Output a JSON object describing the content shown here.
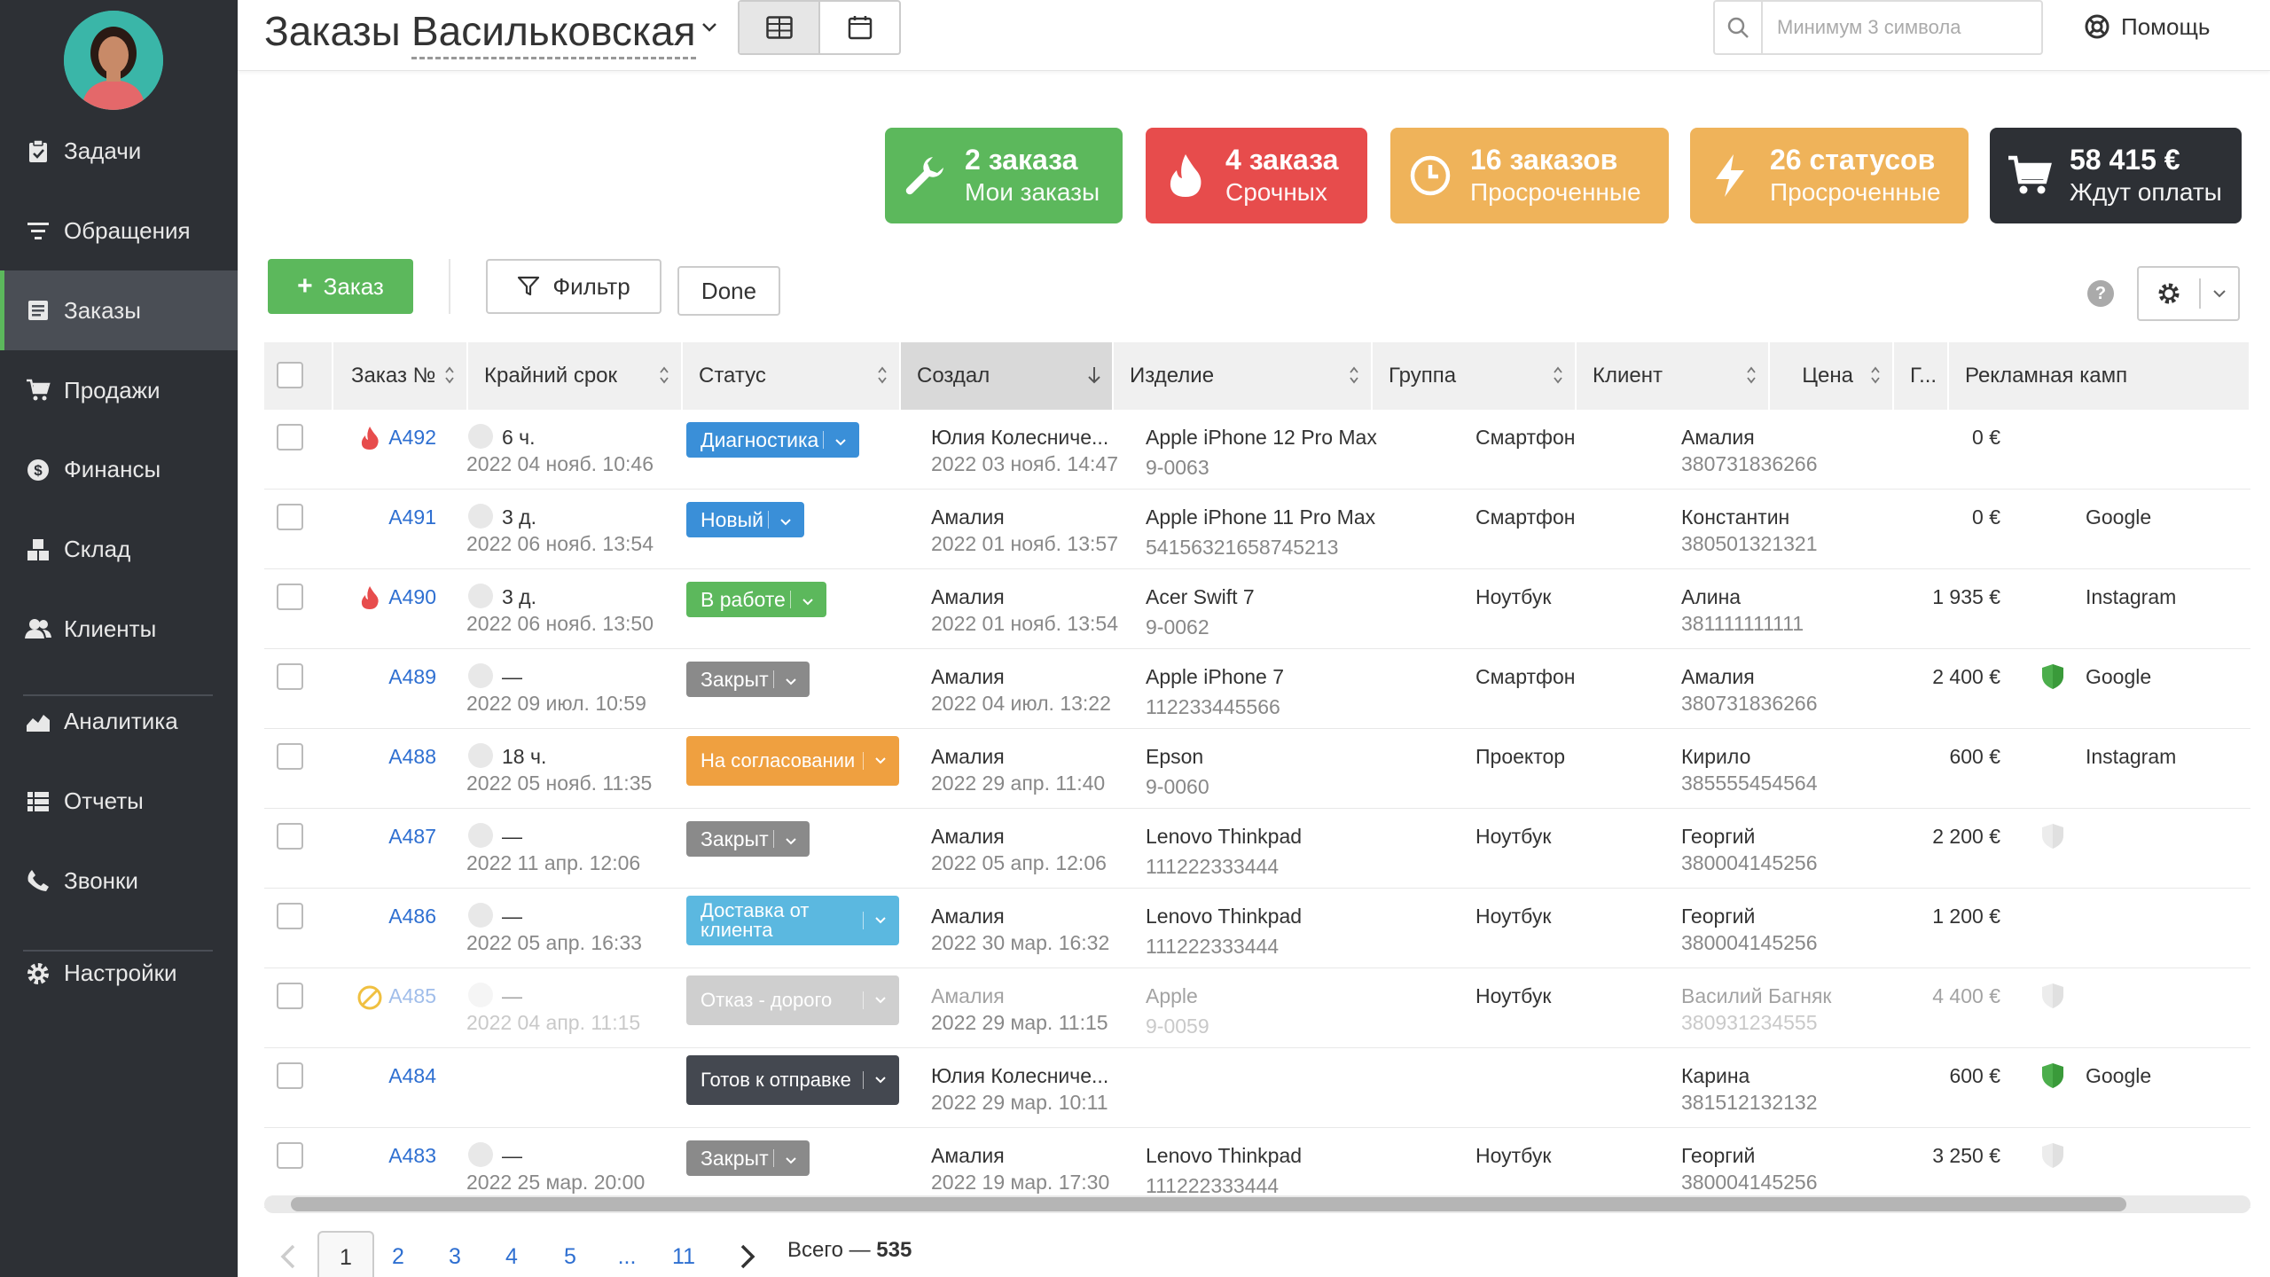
{
  "sidebar": {
    "items": [
      {
        "label": "Задачи",
        "icon": "clipboard-check-icon"
      },
      {
        "label": "Обращения",
        "icon": "filter-lines-icon"
      },
      {
        "label": "Заказы",
        "icon": "order-list-icon",
        "active": true
      },
      {
        "label": "Продажи",
        "icon": "cart-icon"
      },
      {
        "label": "Финансы",
        "icon": "dollar-circle-icon"
      },
      {
        "label": "Склад",
        "icon": "boxes-icon"
      },
      {
        "label": "Клиенты",
        "icon": "users-icon"
      },
      {
        "label": "Аналитика",
        "icon": "area-chart-icon"
      },
      {
        "label": "Отчеты",
        "icon": "list-report-icon"
      },
      {
        "label": "Звонки",
        "icon": "phone-icon"
      },
      {
        "label": "Настройки",
        "icon": "gear-icon"
      }
    ]
  },
  "header": {
    "title": "Заказы",
    "branch": "Васильковская",
    "search_placeholder": "Минимум 3 символа",
    "help": "Помощь"
  },
  "cards": [
    {
      "count": "2 заказа",
      "label": "Мои заказы",
      "color": "#5cb85c",
      "icon": "wrench-icon"
    },
    {
      "count": "4 заказа",
      "label": "Срочных",
      "color": "#e74c4c",
      "icon": "fire-icon"
    },
    {
      "count": "16 заказов",
      "label": "Просроченные",
      "color": "#efb35a",
      "icon": "clock-icon"
    },
    {
      "count": "26 статусов",
      "label": "Просроченные",
      "color": "#efb35a",
      "icon": "lightning-icon"
    },
    {
      "count": "58 415 €",
      "label": "Ждут оплаты",
      "color": "#2d3035",
      "icon": "cart-icon"
    }
  ],
  "toolbar": {
    "add_label": "Заказ",
    "filter_label": "Фильтр",
    "done_label": "Done",
    "help_mark": "?"
  },
  "table": {
    "columns": [
      "Заказ №",
      "Крайний срок",
      "Статус",
      "Создал",
      "Изделие",
      "Группа",
      "Клиент",
      "Цена",
      "Г...",
      "Рекламная камп"
    ],
    "rows": [
      {
        "urgent": true,
        "num": "A492",
        "deadline": "6 ч.",
        "deadline_date": "2022 04 нояб. 10:46",
        "status": "Диагностика",
        "status_color": "#3a8fd8",
        "creator": "Юлия Колесниче...",
        "created": "2022 03 нояб. 14:47",
        "item": "Apple iPhone 12 Pro Max",
        "serial": "9-0063",
        "group": "Смартфон",
        "client": "Амалия",
        "phone": "380731836266",
        "price": "0 €",
        "shield": "",
        "campaign": ""
      },
      {
        "urgent": false,
        "num": "A491",
        "deadline": "3 д.",
        "deadline_date": "2022 06 нояб. 13:54",
        "status": "Новый",
        "status_color": "#3a8fd8",
        "creator": "Амалия",
        "created": "2022 01 нояб. 13:57",
        "item": "Apple iPhone 11 Pro Max",
        "serial": "54156321658745213",
        "group": "Смартфон",
        "client": "Константин",
        "phone": "380501321321",
        "price": "0 €",
        "shield": "",
        "campaign": "Google"
      },
      {
        "urgent": true,
        "num": "A490",
        "deadline": "3 д.",
        "deadline_date": "2022 06 нояб. 13:50",
        "status": "В работе",
        "status_color": "#5cb85c",
        "creator": "Амалия",
        "created": "2022 01 нояб. 13:54",
        "item": "Acer Swift 7",
        "serial": "9-0062",
        "group": "Ноутбук",
        "client": "Алина",
        "phone": "381111111111",
        "price": "1 935 €",
        "shield": "",
        "campaign": "Instagram"
      },
      {
        "urgent": false,
        "num": "A489",
        "deadline": "—",
        "deadline_date": "2022 09 июл. 10:59",
        "status": "Закрыт",
        "status_color": "#8a8a8a",
        "creator": "Амалия",
        "created": "2022 04 июл. 13:22",
        "item": "Apple iPhone 7",
        "serial": "112233445566",
        "group": "Смартфон",
        "client": "Амалия",
        "phone": "380731836266",
        "price": "2 400 €",
        "shield": "green",
        "campaign": "Google"
      },
      {
        "urgent": false,
        "num": "A488",
        "deadline": "18 ч.",
        "deadline_date": "2022 05 нояб. 11:35",
        "status": "На согласовании",
        "status_color": "#efa040",
        "creator": "Амалия",
        "created": "2022 29 апр. 11:40",
        "item": "Epson",
        "serial": "9-0060",
        "group": "Проектор",
        "client": "Кирило",
        "phone": "385555454564",
        "price": "600 €",
        "shield": "",
        "campaign": "Instagram"
      },
      {
        "urgent": false,
        "num": "A487",
        "deadline": "—",
        "deadline_date": "2022 11 апр. 12:06",
        "status": "Закрыт",
        "status_color": "#8a8a8a",
        "creator": "Амалия",
        "created": "2022 05 апр. 12:06",
        "item": "Lenovo Thinkpad",
        "serial": "111222333444",
        "group": "Ноутбук",
        "client": "Георгий",
        "phone": "380004145256",
        "price": "2 200 €",
        "shield": "grey",
        "campaign": ""
      },
      {
        "urgent": false,
        "num": "A486",
        "deadline": "—",
        "deadline_date": "2022 05 апр. 16:33",
        "status": "Доставка от клиента",
        "status_color": "#5bb8e0",
        "creator": "Амалия",
        "created": "2022 30 мар. 16:32",
        "item": "Lenovo Thinkpad",
        "serial": "111222333444",
        "group": "Ноутбук",
        "client": "Георгий",
        "phone": "380004145256",
        "price": "1 200 €",
        "shield": "",
        "campaign": ""
      },
      {
        "urgent": false,
        "cancelled": true,
        "num": "A485",
        "deadline": "—",
        "deadline_date": "2022 04 апр. 11:15",
        "status": "Отказ - дорого",
        "status_color": "#cfcfcf",
        "creator": "Амалия",
        "created": "2022 29 мар. 11:15",
        "item": "Apple",
        "serial": "9-0059",
        "group": "Ноутбук",
        "client": "Василий Багняк",
        "phone": "380931234555",
        "price": "4 400 €",
        "shield": "grey",
        "campaign": ""
      },
      {
        "urgent": false,
        "num": "A484",
        "deadline": "",
        "deadline_date": "",
        "status": "Готов к отправке",
        "status_color": "#444850",
        "creator": "Юлия Колесниче...",
        "created": "2022 29 мар. 10:11",
        "item": "",
        "serial": "",
        "group": "",
        "client": "Карина",
        "phone": "381512132132",
        "price": "600 €",
        "shield": "green",
        "campaign": "Google"
      },
      {
        "urgent": false,
        "num": "A483",
        "deadline": "—",
        "deadline_date": "2022 25 мар. 20:00",
        "status": "Закрыт",
        "status_color": "#8a8a8a",
        "creator": "Амалия",
        "created": "2022 19 мар. 17:30",
        "item": "Lenovo Thinkpad",
        "serial": "111222333444",
        "group": "Ноутбук",
        "client": "Георгий",
        "phone": "380004145256",
        "price": "3 250 €",
        "shield": "grey",
        "campaign": ""
      }
    ]
  },
  "pagination": {
    "pages": [
      "1",
      "2",
      "3",
      "4",
      "5",
      "...",
      "11"
    ],
    "current": "1",
    "total_label": "Всего —",
    "total": "535"
  }
}
